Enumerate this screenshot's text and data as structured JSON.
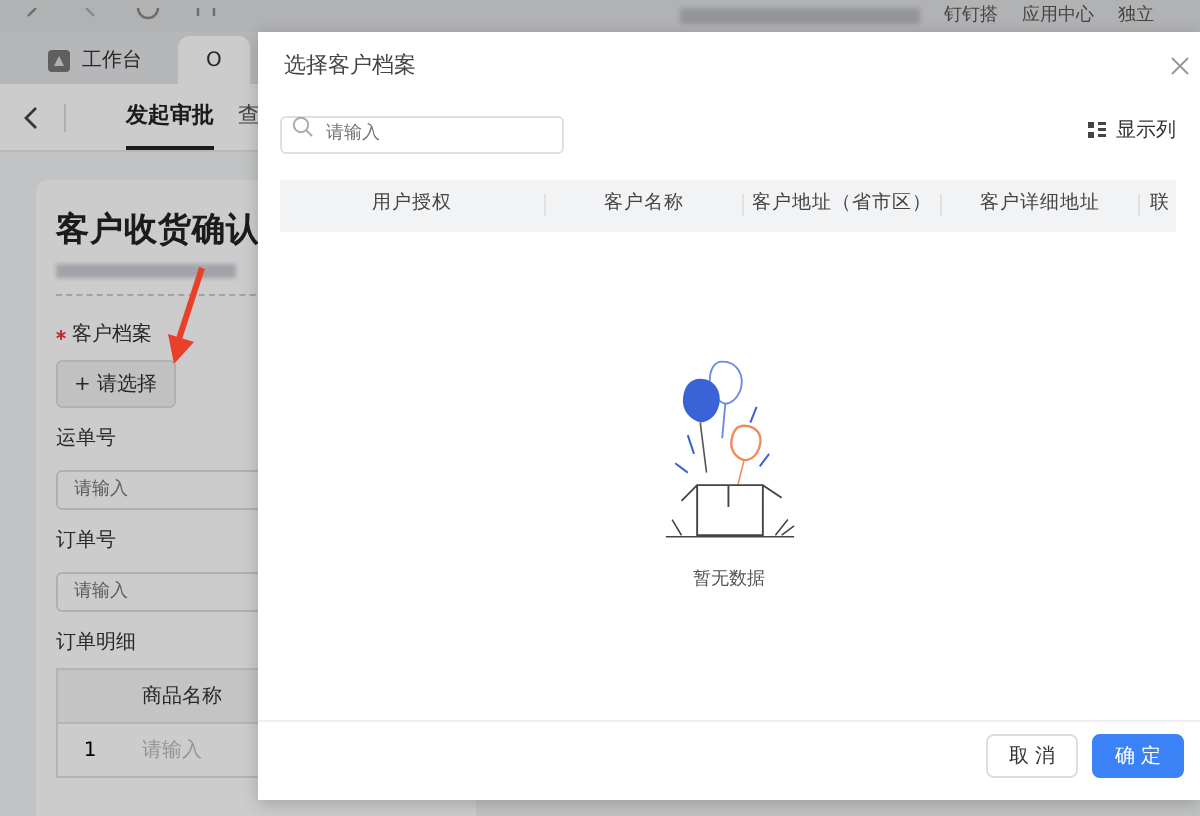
{
  "browser_bar": {
    "links": [
      {
        "label": "钉钉搭"
      },
      {
        "label": "应用中心"
      },
      {
        "label": "独立"
      }
    ]
  },
  "tabs": [
    {
      "label": "工作台",
      "selected": false
    },
    {
      "label": "O",
      "selected": true
    }
  ],
  "nav": {
    "items": [
      {
        "label": "发起审批",
        "selected": true
      },
      {
        "label": "查",
        "selected": false
      }
    ]
  },
  "form": {
    "title": "客户收货确认",
    "fields": [
      {
        "kind": "picker",
        "label": "客户档案",
        "required": true,
        "button": "+ 请选择"
      },
      {
        "kind": "input",
        "label": "运单号",
        "required": false,
        "placeholder": "请输入"
      },
      {
        "kind": "input",
        "label": "订单号",
        "required": false,
        "placeholder": "请输入"
      }
    ],
    "detail": {
      "label": "订单明细",
      "columns": [
        "商品名称"
      ],
      "rows": [
        {
          "index": "1",
          "placeholder": "请输入"
        }
      ]
    }
  },
  "dialog": {
    "title": "选择客户档案",
    "search": {
      "placeholder": "请输入"
    },
    "columns_button": "显示列",
    "columns": [
      "用户授权",
      "客户名称",
      "客户地址（省市区）",
      "客户详细地址",
      "联"
    ],
    "empty_text": "暂无数据",
    "buttons": [
      {
        "label": "取 消",
        "kind": "default"
      },
      {
        "label": "确 定",
        "kind": "primary"
      }
    ]
  }
}
